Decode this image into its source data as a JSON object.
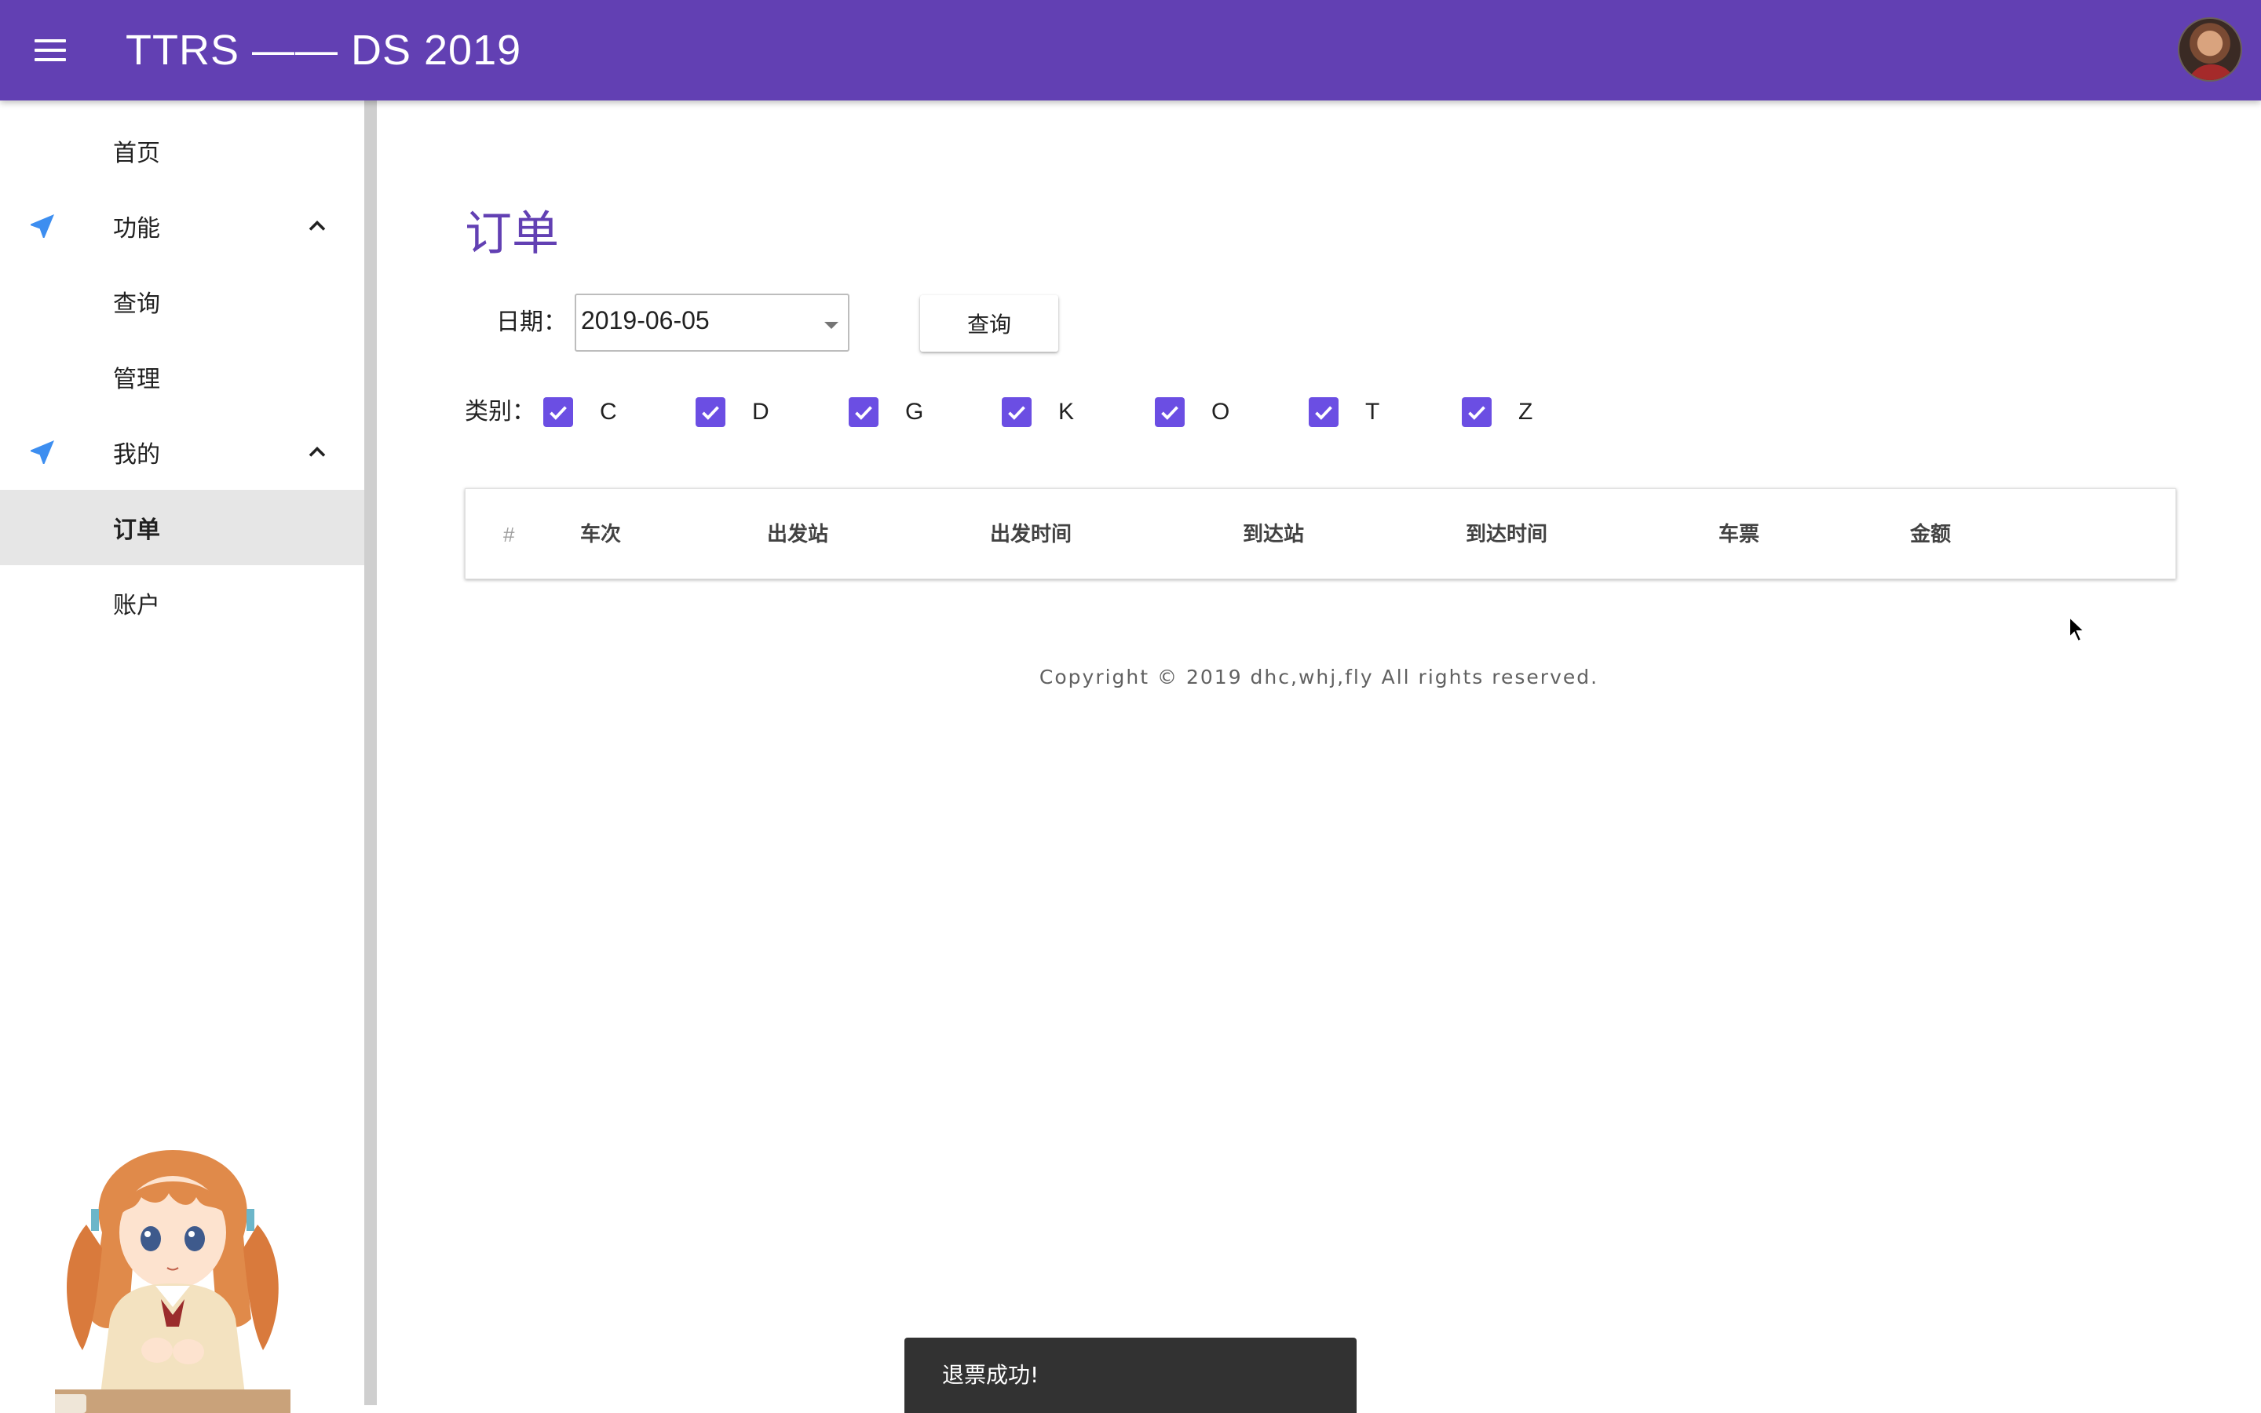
{
  "app": {
    "title": "TTRS —— DS 2019",
    "menu_icon": "hamburger-menu-icon",
    "avatar": "user-avatar",
    "brand_color": "#6240b3"
  },
  "sidebar": {
    "items": [
      {
        "label": "首页"
      },
      {
        "label": "功能",
        "icon": "navigation-arrow-icon",
        "expanded": true
      },
      {
        "label": "查询"
      },
      {
        "label": "管理"
      },
      {
        "label": "我的",
        "icon": "navigation-arrow-icon",
        "expanded": true
      },
      {
        "label": "订单",
        "active": true
      },
      {
        "label": "账户"
      }
    ]
  },
  "main": {
    "page_title": "订单",
    "date_label": "日期：",
    "date_value": "2019-06-05",
    "query_label": "查询",
    "category_label": "类别：",
    "categories": [
      {
        "label": "C",
        "checked": true
      },
      {
        "label": "D",
        "checked": true
      },
      {
        "label": "G",
        "checked": true
      },
      {
        "label": "K",
        "checked": true
      },
      {
        "label": "O",
        "checked": true
      },
      {
        "label": "T",
        "checked": true
      },
      {
        "label": "Z",
        "checked": true
      }
    ],
    "table": {
      "columns": [
        "#",
        "车次",
        "出发站",
        "出发时间",
        "到达站",
        "到达时间",
        "车票",
        "金额"
      ],
      "rows": []
    },
    "copyright": "Copyright © 2019 dhc,whj,fly All rights reserved."
  },
  "snackbar": {
    "message": "退票成功!"
  }
}
